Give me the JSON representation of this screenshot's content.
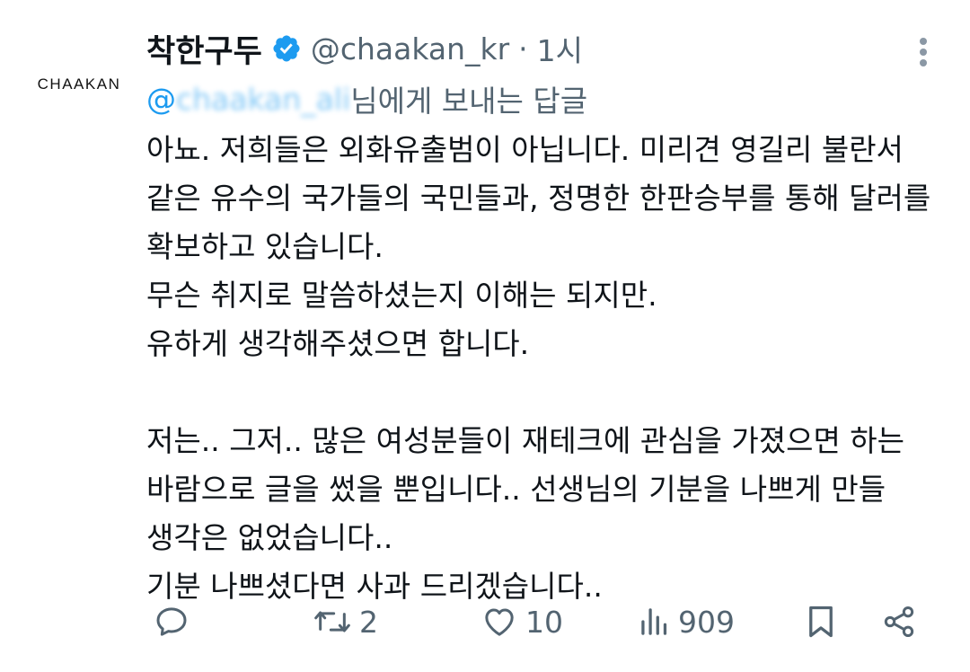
{
  "author": {
    "avatar_logo": "CHAAKAN",
    "display_name": "착한구두",
    "handle": "@chaakan_kr",
    "separator": "·",
    "time": "1시"
  },
  "reply_to": {
    "mention_prefix": "@",
    "mention_redacted": "chaakan_ali",
    "suffix": "님에게 보내는 답글"
  },
  "body_lines": [
    "아뇨. 저희들은 외화유출범이 아닙니다. 미리견 영길리 불란서",
    "같은 유수의 국가들의 국민들과, 정명한 한판승부를 통해 달러를",
    "확보하고 있습니다.",
    "무슨 취지로 말씀하셨는지 이해는 되지만.",
    "유하게 생각해주셨으면 합니다.",
    "",
    "저는.. 그저.. 많은 여성분들이 재테크에 관심을 가졌으면 하는",
    "바람으로 글을 썼을 뿐입니다.. 선생님의 기분을 나쁘게 만들",
    "생각은 없었습니다..",
    "기분 나쁘셨다면 사과 드리겠습니다.."
  ],
  "actions": {
    "reply_icon": "reply-icon",
    "retweet_count": "2",
    "like_count": "10",
    "views_count": "909",
    "bookmark_icon": "bookmark-icon",
    "share_icon": "share-icon"
  },
  "colors": {
    "text": "#0f1419",
    "secondary": "#536471",
    "accent": "#1d9bf0"
  }
}
